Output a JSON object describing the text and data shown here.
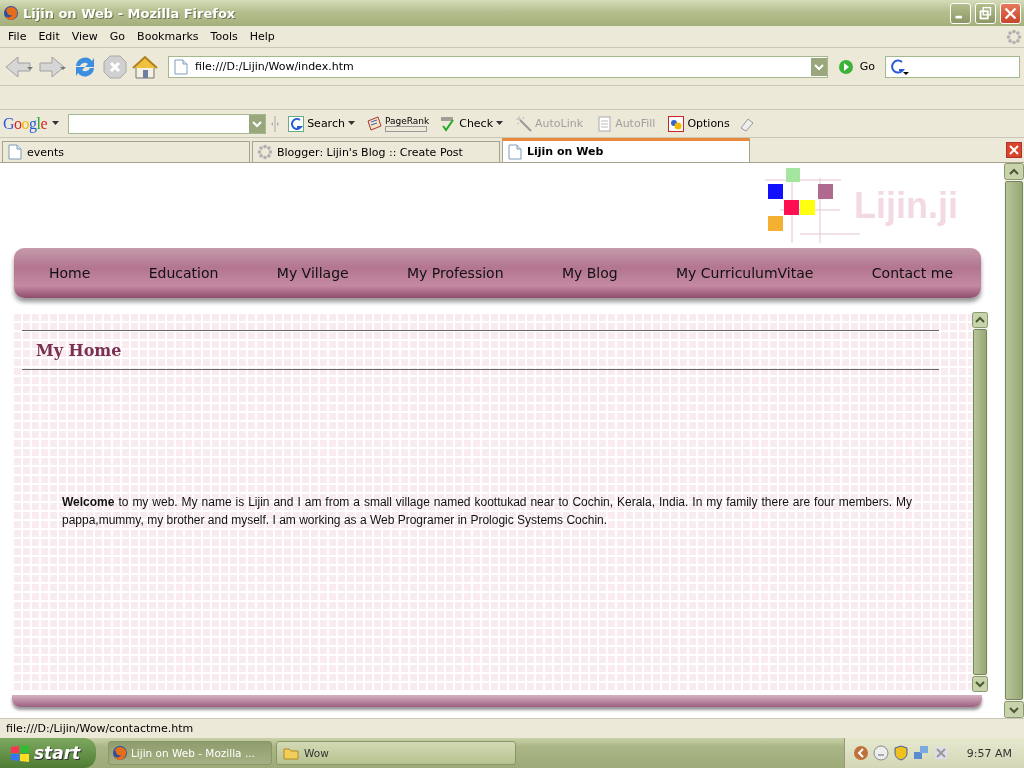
{
  "window": {
    "title": "Lijin on Web - Mozilla Firefox"
  },
  "menu": [
    "File",
    "Edit",
    "View",
    "Go",
    "Bookmarks",
    "Tools",
    "Help"
  ],
  "navigation": {
    "url": "file:///D:/Lijin/Wow/index.htm",
    "go_label": "Go"
  },
  "google_toolbar": {
    "brand": "Google",
    "items": [
      {
        "kind": "search",
        "label": "Search",
        "disabled": false
      },
      {
        "kind": "pagerank",
        "label": "PageRank",
        "disabled": false
      },
      {
        "kind": "check",
        "label": "Check",
        "disabled": false
      },
      {
        "kind": "autolink",
        "label": "AutoLink",
        "disabled": true
      },
      {
        "kind": "autofill",
        "label": "AutoFill",
        "disabled": true
      },
      {
        "kind": "options",
        "label": "Options",
        "disabled": false
      }
    ]
  },
  "tabs": [
    {
      "label": "events",
      "selected": false
    },
    {
      "label": "Blogger: Lijin's Blog :: Create Post",
      "selected": false
    },
    {
      "label": "Lijin on Web",
      "selected": true
    }
  ],
  "page": {
    "logo": "Lijin.ji",
    "nav": [
      "Home",
      "Education",
      "My Village",
      "My Profession",
      "My Blog",
      "My CurriculumVitae",
      "Contact me"
    ],
    "heading": "My Home",
    "paragraph": "**Welcome** to my web. My name is Lijin and I am from a small village named koottukad near to Cochin, Kerala, India. In my family there are four members. My pappa,mummy, my brother and myself. I am working as a Web Programer in Prologic Systems Cochin."
  },
  "status_bar": "file:///D:/Lijin/Wow/contactme.htm",
  "taskbar": {
    "start": "start",
    "tasks": [
      {
        "label": "Lijin on Web - Mozilla ...",
        "kind": "browser",
        "selected": true
      },
      {
        "label": "Wow",
        "kind": "folder",
        "selected": false
      }
    ],
    "clock": "9:57 AM"
  }
}
